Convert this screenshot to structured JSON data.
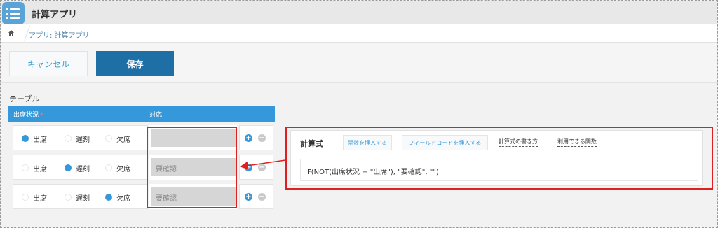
{
  "app": {
    "title": "計算アプリ"
  },
  "breadcrumb": {
    "text": "アプリ: 計算アプリ"
  },
  "actions": {
    "cancel_label": "キャンセル",
    "save_label": "保存"
  },
  "table": {
    "label": "テーブル",
    "columns": [
      "出席状況",
      "対応"
    ],
    "options": [
      "出席",
      "遅刻",
      "欠席"
    ],
    "rows": [
      {
        "selected": "出席",
        "value": ""
      },
      {
        "selected": "遅刻",
        "value": "要確認"
      },
      {
        "selected": "欠席",
        "value": "要確認"
      }
    ]
  },
  "formula_panel": {
    "title": "計算式",
    "insert_function": "関数を挿入する",
    "insert_field_code": "フィールドコードを挿入する",
    "how_to_write": "計算式の書き方",
    "available_functions": "利用できる関数",
    "expression": "IF(NOT(出席状況 = \"出席\"), \"要確認\", \"\")"
  },
  "colors": {
    "accent": "#3498db",
    "primary_button": "#1e6fa6",
    "highlight": "#e02020"
  }
}
